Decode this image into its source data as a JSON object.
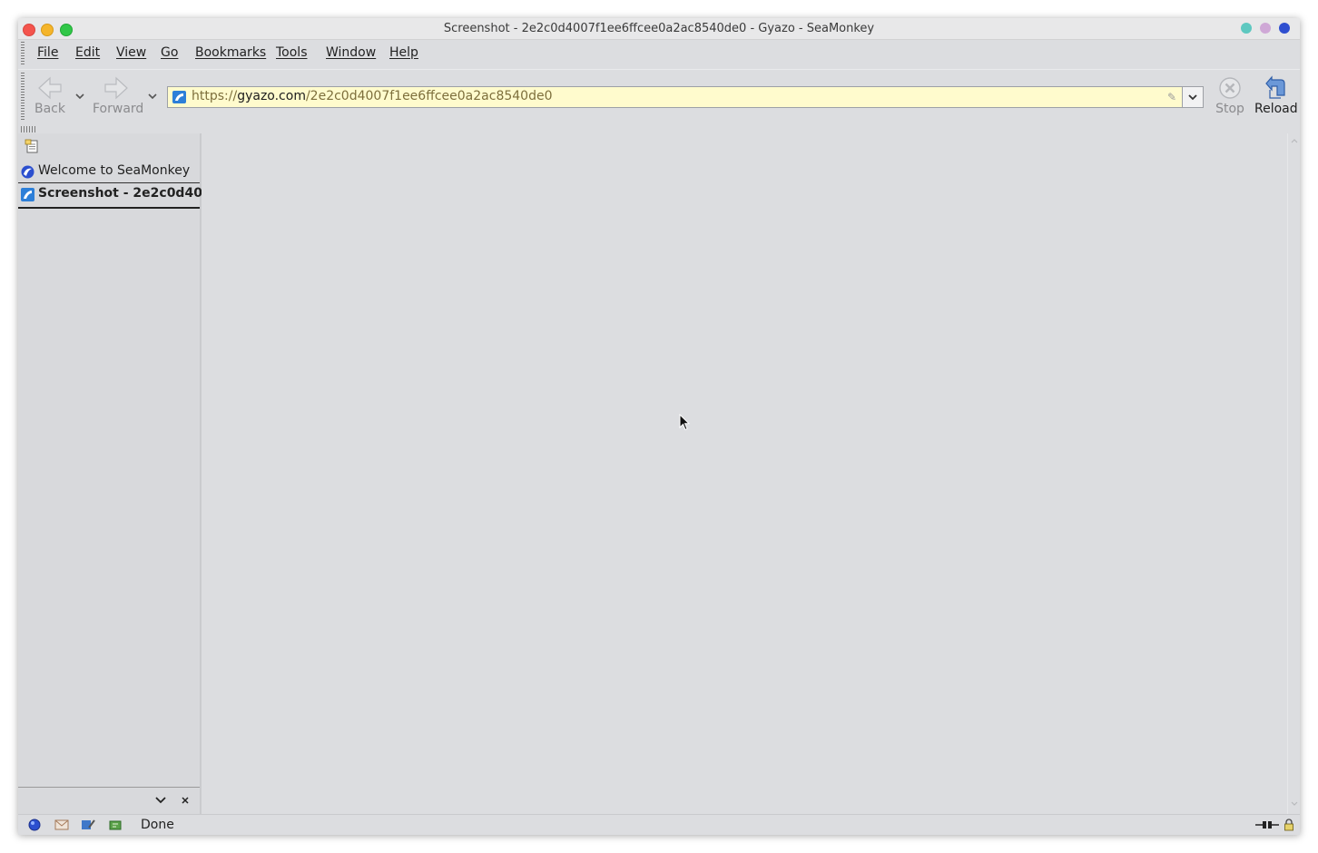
{
  "window": {
    "title": "Screenshot - 2e2c0d4007f1ee6ffcee0a2ac8540de0 - Gyazo - SeaMonkey"
  },
  "menu": {
    "items": [
      "File",
      "Edit",
      "View",
      "Go",
      "Bookmarks",
      "Tools",
      "Window",
      "Help"
    ]
  },
  "toolbar": {
    "back_label": "Back",
    "forward_label": "Forward",
    "stop_label": "Stop",
    "reload_label": "Reload",
    "back_enabled": false,
    "forward_enabled": false,
    "stop_enabled": false
  },
  "urlbar": {
    "scheme": "https://",
    "host": "gyazo.com",
    "path": "/2e2c0d4007f1ee6ffcee0a2ac8540de0",
    "background_color": "#fffbcd"
  },
  "sidebar": {
    "tabs": [
      {
        "label": "Welcome to SeaMonkey",
        "icon": "seamonkey-globe-icon",
        "selected": false
      },
      {
        "label": "Screenshot - 2e2c0d400...",
        "icon": "gyazo-icon",
        "selected": true
      }
    ]
  },
  "statusbar": {
    "text": "Done",
    "icons": [
      "navigator-icon",
      "mail-icon",
      "composer-icon",
      "chatzilla-icon"
    ]
  }
}
